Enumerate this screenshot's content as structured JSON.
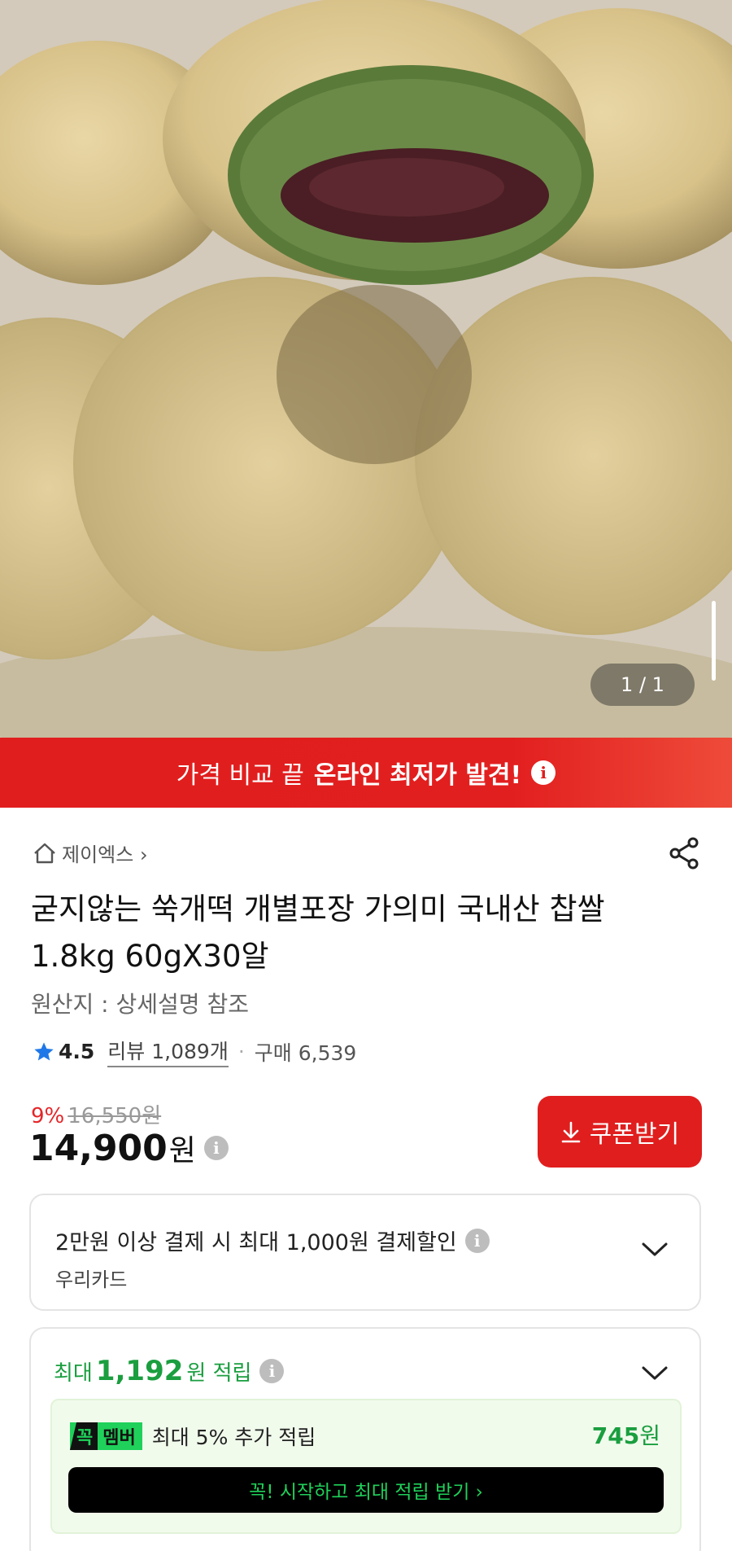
{
  "gallery": {
    "counter": "1 / 1"
  },
  "banner": {
    "text_normal": "가격 비교 끝",
    "text_bold": "온라인 최저가 발견!",
    "info_icon": "info-icon"
  },
  "seller": {
    "name": "제이엑스 ›"
  },
  "product": {
    "title": "굳지않는 쑥개떡 개별포장 가의미 국내산 찹쌀 1.8kg 60gX30알",
    "origin": "원산지 : 상세설명 참조",
    "rating": "4.5",
    "review": "리뷰 1,089개",
    "purchases": "구매 6,539"
  },
  "price": {
    "discount_pct": "9%",
    "original": "16,550",
    "original_unit": "원",
    "current": "14,900",
    "unit": "원",
    "coupon_button": "쿠폰받기"
  },
  "payment_card": {
    "title": "2만원 이상 결제 시 최대 1,000원 결제할인",
    "card_name": "우리카드"
  },
  "points_card": {
    "prefix": "최대",
    "amount": "1,192",
    "suffix": "원 적립",
    "member_badge_k": "꼭",
    "member_badge_m": "멤버",
    "member_text": "최대 5% 추가 적립",
    "member_amount": "745",
    "member_unit": "원",
    "member_button": "꼭! 시작하고 최대 적립 받기 ›"
  },
  "colors": {
    "accent_red": "#e01e1e",
    "points_green": "#1a9e3f",
    "member_green": "#1fd15a"
  }
}
